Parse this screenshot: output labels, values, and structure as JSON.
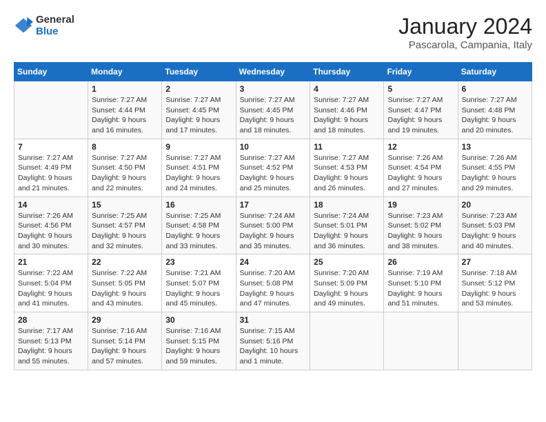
{
  "header": {
    "logo": {
      "general": "General",
      "blue": "Blue"
    },
    "title": "January 2024",
    "location": "Pascarola, Campania, Italy"
  },
  "days_of_week": [
    "Sunday",
    "Monday",
    "Tuesday",
    "Wednesday",
    "Thursday",
    "Friday",
    "Saturday"
  ],
  "weeks": [
    [
      {
        "day": null,
        "sunrise": null,
        "sunset": null,
        "daylight": null
      },
      {
        "day": "1",
        "sunrise": "7:27 AM",
        "sunset": "4:44 PM",
        "daylight": "9 hours and 16 minutes."
      },
      {
        "day": "2",
        "sunrise": "7:27 AM",
        "sunset": "4:45 PM",
        "daylight": "9 hours and 17 minutes."
      },
      {
        "day": "3",
        "sunrise": "7:27 AM",
        "sunset": "4:45 PM",
        "daylight": "9 hours and 18 minutes."
      },
      {
        "day": "4",
        "sunrise": "7:27 AM",
        "sunset": "4:46 PM",
        "daylight": "9 hours and 18 minutes."
      },
      {
        "day": "5",
        "sunrise": "7:27 AM",
        "sunset": "4:47 PM",
        "daylight": "9 hours and 19 minutes."
      },
      {
        "day": "6",
        "sunrise": "7:27 AM",
        "sunset": "4:48 PM",
        "daylight": "9 hours and 20 minutes."
      }
    ],
    [
      {
        "day": "7",
        "sunrise": "7:27 AM",
        "sunset": "4:49 PM",
        "daylight": "9 hours and 21 minutes."
      },
      {
        "day": "8",
        "sunrise": "7:27 AM",
        "sunset": "4:50 PM",
        "daylight": "9 hours and 22 minutes."
      },
      {
        "day": "9",
        "sunrise": "7:27 AM",
        "sunset": "4:51 PM",
        "daylight": "9 hours and 24 minutes."
      },
      {
        "day": "10",
        "sunrise": "7:27 AM",
        "sunset": "4:52 PM",
        "daylight": "9 hours and 25 minutes."
      },
      {
        "day": "11",
        "sunrise": "7:27 AM",
        "sunset": "4:53 PM",
        "daylight": "9 hours and 26 minutes."
      },
      {
        "day": "12",
        "sunrise": "7:26 AM",
        "sunset": "4:54 PM",
        "daylight": "9 hours and 27 minutes."
      },
      {
        "day": "13",
        "sunrise": "7:26 AM",
        "sunset": "4:55 PM",
        "daylight": "9 hours and 29 minutes."
      }
    ],
    [
      {
        "day": "14",
        "sunrise": "7:26 AM",
        "sunset": "4:56 PM",
        "daylight": "9 hours and 30 minutes."
      },
      {
        "day": "15",
        "sunrise": "7:25 AM",
        "sunset": "4:57 PM",
        "daylight": "9 hours and 32 minutes."
      },
      {
        "day": "16",
        "sunrise": "7:25 AM",
        "sunset": "4:58 PM",
        "daylight": "9 hours and 33 minutes."
      },
      {
        "day": "17",
        "sunrise": "7:24 AM",
        "sunset": "5:00 PM",
        "daylight": "9 hours and 35 minutes."
      },
      {
        "day": "18",
        "sunrise": "7:24 AM",
        "sunset": "5:01 PM",
        "daylight": "9 hours and 36 minutes."
      },
      {
        "day": "19",
        "sunrise": "7:23 AM",
        "sunset": "5:02 PM",
        "daylight": "9 hours and 38 minutes."
      },
      {
        "day": "20",
        "sunrise": "7:23 AM",
        "sunset": "5:03 PM",
        "daylight": "9 hours and 40 minutes."
      }
    ],
    [
      {
        "day": "21",
        "sunrise": "7:22 AM",
        "sunset": "5:04 PM",
        "daylight": "9 hours and 41 minutes."
      },
      {
        "day": "22",
        "sunrise": "7:22 AM",
        "sunset": "5:05 PM",
        "daylight": "9 hours and 43 minutes."
      },
      {
        "day": "23",
        "sunrise": "7:21 AM",
        "sunset": "5:07 PM",
        "daylight": "9 hours and 45 minutes."
      },
      {
        "day": "24",
        "sunrise": "7:20 AM",
        "sunset": "5:08 PM",
        "daylight": "9 hours and 47 minutes."
      },
      {
        "day": "25",
        "sunrise": "7:20 AM",
        "sunset": "5:09 PM",
        "daylight": "9 hours and 49 minutes."
      },
      {
        "day": "26",
        "sunrise": "7:19 AM",
        "sunset": "5:10 PM",
        "daylight": "9 hours and 51 minutes."
      },
      {
        "day": "27",
        "sunrise": "7:18 AM",
        "sunset": "5:12 PM",
        "daylight": "9 hours and 53 minutes."
      }
    ],
    [
      {
        "day": "28",
        "sunrise": "7:17 AM",
        "sunset": "5:13 PM",
        "daylight": "9 hours and 55 minutes."
      },
      {
        "day": "29",
        "sunrise": "7:16 AM",
        "sunset": "5:14 PM",
        "daylight": "9 hours and 57 minutes."
      },
      {
        "day": "30",
        "sunrise": "7:16 AM",
        "sunset": "5:15 PM",
        "daylight": "9 hours and 59 minutes."
      },
      {
        "day": "31",
        "sunrise": "7:15 AM",
        "sunset": "5:16 PM",
        "daylight": "10 hours and 1 minute."
      },
      {
        "day": null,
        "sunrise": null,
        "sunset": null,
        "daylight": null
      },
      {
        "day": null,
        "sunrise": null,
        "sunset": null,
        "daylight": null
      },
      {
        "day": null,
        "sunrise": null,
        "sunset": null,
        "daylight": null
      }
    ]
  ]
}
